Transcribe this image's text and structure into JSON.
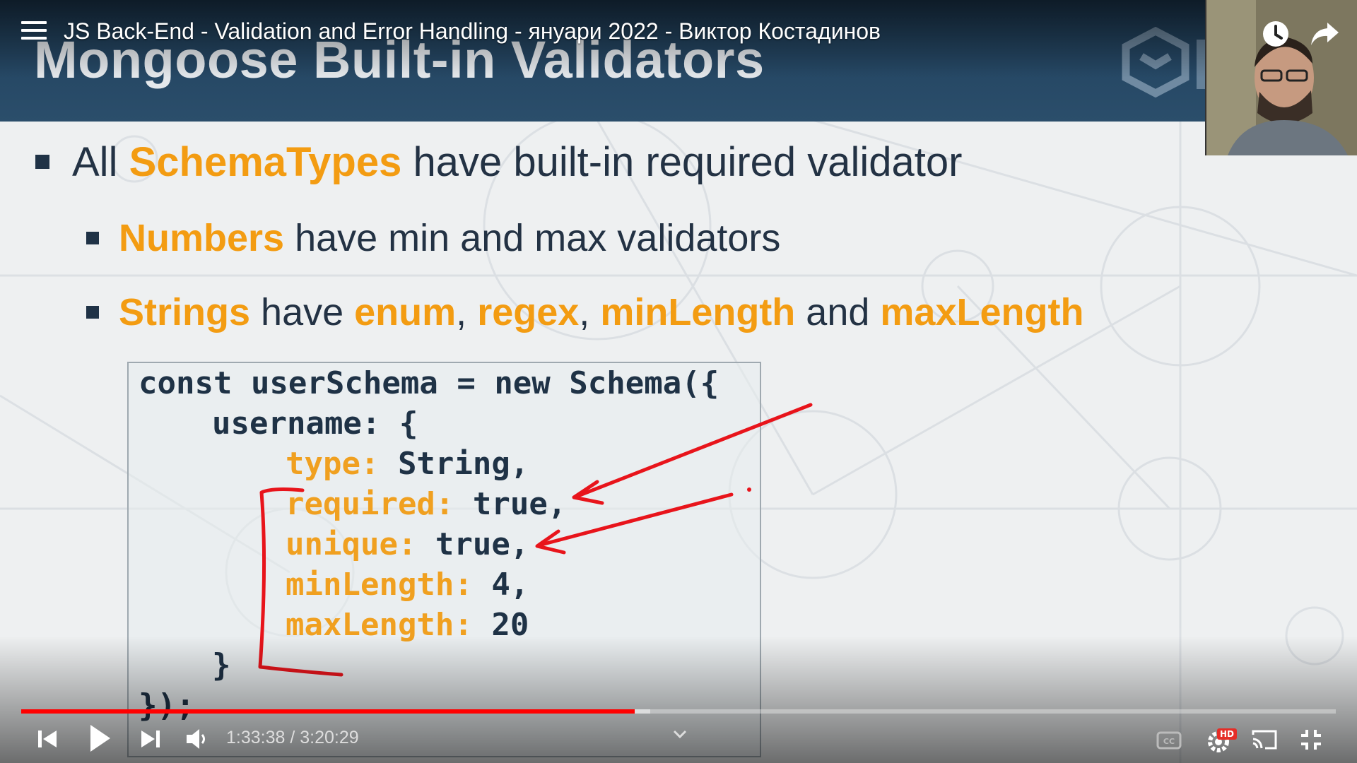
{
  "video": {
    "title": "JS Back-End - Validation and Error Handling - януари 2022 - Виктор Костадинов",
    "current_time": "1:33:38",
    "duration": "3:20:29",
    "time_separator": " / ",
    "progress": 0.4665,
    "quality_badge": "HD"
  },
  "slide": {
    "title": "Mongoose Built-in Validators",
    "bullets": [
      {
        "parts": [
          {
            "text": "All ",
            "hl": false
          },
          {
            "text": "SchemaTypes",
            "hl": true
          },
          {
            "text": " have built-in required validator",
            "hl": false
          }
        ]
      },
      {
        "parts": [
          {
            "text": "Numbers",
            "hl": true
          },
          {
            "text": " have min and max validators",
            "hl": false
          }
        ]
      },
      {
        "parts": [
          {
            "text": "Strings",
            "hl": true
          },
          {
            "text": " have ",
            "hl": false
          },
          {
            "text": "enum",
            "hl": true
          },
          {
            "text": ", ",
            "hl": false
          },
          {
            "text": "regex",
            "hl": true
          },
          {
            "text": ", ",
            "hl": false
          },
          {
            "text": "minLength",
            "hl": true
          },
          {
            "text": " and ",
            "hl": false
          },
          {
            "text": "maxLength",
            "hl": true
          }
        ]
      }
    ],
    "code": [
      {
        "indent": 0,
        "parts": [
          {
            "text": "const userSchema = new Schema({",
            "cls": "kw"
          }
        ]
      },
      {
        "indent": 1,
        "parts": [
          {
            "text": "username: {",
            "cls": "kw"
          }
        ]
      },
      {
        "indent": 2,
        "parts": [
          {
            "text": "type:",
            "cls": "key"
          },
          {
            "text": " String,",
            "cls": "kw"
          }
        ]
      },
      {
        "indent": 2,
        "parts": [
          {
            "text": "required:",
            "cls": "key"
          },
          {
            "text": " true,",
            "cls": "kw"
          }
        ]
      },
      {
        "indent": 2,
        "parts": [
          {
            "text": "unique:",
            "cls": "key"
          },
          {
            "text": " true,",
            "cls": "kw"
          }
        ]
      },
      {
        "indent": 2,
        "parts": [
          {
            "text": "minLength:",
            "cls": "key"
          },
          {
            "text": " 4,",
            "cls": "kw"
          }
        ]
      },
      {
        "indent": 2,
        "parts": [
          {
            "text": "maxLength:",
            "cls": "key"
          },
          {
            "text": " 20",
            "cls": "kw"
          }
        ]
      },
      {
        "indent": 1,
        "parts": [
          {
            "text": "}",
            "cls": "kw"
          }
        ]
      },
      {
        "indent": 0,
        "parts": [
          {
            "text": "});",
            "cls": "kw"
          }
        ]
      }
    ]
  },
  "icons": {
    "menu": "menu-icon",
    "watch_later": "clock-icon",
    "share": "share-arrow-icon",
    "prev": "previous-icon",
    "play": "play-icon",
    "next": "next-icon",
    "volume": "volume-icon",
    "captions": "captions-icon",
    "settings": "gear-icon",
    "cast": "cast-icon",
    "fullscreen": "exit-fullscreen-icon",
    "chevron": "chevron-down-icon"
  },
  "colors": {
    "accent_orange": "#f39c12",
    "header_blue": "#264865",
    "text_dark": "#233244",
    "progress_red": "#ff0000",
    "annotation_red": "#e8141b"
  }
}
